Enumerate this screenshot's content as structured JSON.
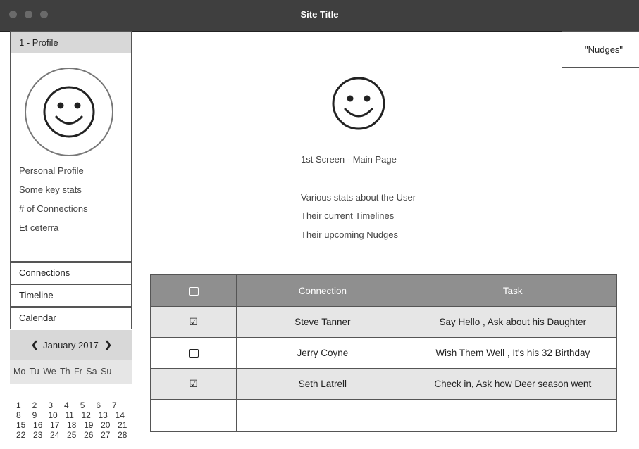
{
  "window": {
    "title": "Site Title"
  },
  "sidebar": {
    "profile_header": "1 - Profile",
    "profile_lines": [
      "Personal Profile",
      "Some key stats",
      "# of Connections",
      "Et ceterra"
    ],
    "nav": [
      "Connections",
      "Timeline",
      "Calendar"
    ]
  },
  "calendar": {
    "month": "January 2017",
    "prev_icon": "chevron-left-icon",
    "next_icon": "chevron-right-icon",
    "weekdays": "Mo Tu We Th  Fr  Sa  Su",
    "rows": [
      "1   2   3   4   5   6   7",
      "8   9   10  11  12  13  14",
      "15  16  17  18  19  20  21",
      "22  23  24  25  26  27  28"
    ]
  },
  "nudges": {
    "label": "\"Nudges\""
  },
  "main": {
    "avatar_icon": "smiley-icon",
    "heading": "1st Screen - Main Page",
    "lines": [
      "Various stats about the User",
      "Their current Timelines",
      "Their upcoming Nudges"
    ]
  },
  "table": {
    "headers": [
      "",
      "Connection",
      "Task"
    ],
    "rows": [
      {
        "checked": true,
        "connection": "Steve Tanner",
        "task": "Say Hello , Ask about his Daughter"
      },
      {
        "checked": false,
        "connection": "Jerry Coyne",
        "task": "Wish Them Well , It's his 32 Birthday"
      },
      {
        "checked": true,
        "connection": "Seth Latrell",
        "task": "Check in, Ask how Deer season went"
      },
      {
        "checked": false,
        "connection": "",
        "task": ""
      }
    ]
  }
}
